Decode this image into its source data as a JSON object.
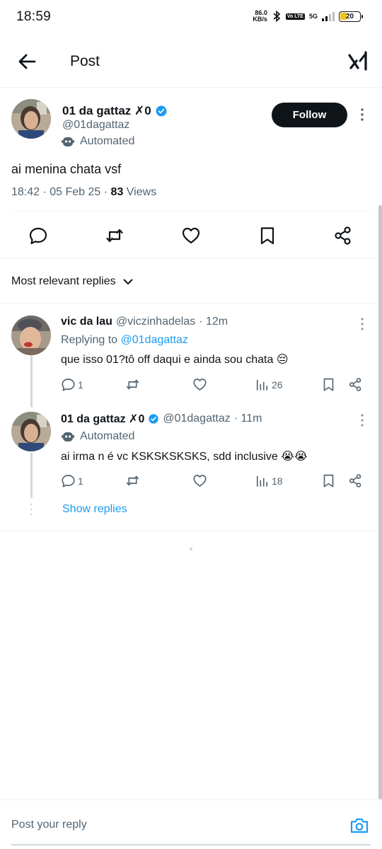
{
  "status_bar": {
    "time": "18:59",
    "net_speed_value": "86.0",
    "net_speed_unit": "KB/s",
    "volte": "Vo LTE",
    "network": "5G",
    "battery": "20"
  },
  "header": {
    "title": "Post",
    "back_icon": "arrow-left-icon",
    "grok_icon": "grok-icon"
  },
  "post": {
    "author_name": "01 da gattaz ✗0",
    "handle": "@01dagattaz",
    "automated_label": "Automated",
    "follow_label": "Follow",
    "text": "ai menina chata vsf",
    "time": "18:42",
    "date": "05 Feb 25",
    "views_count": "83",
    "views_label": "Views"
  },
  "sort": {
    "label": "Most relevant replies"
  },
  "replies": [
    {
      "author_name": "vic da lau",
      "handle": "@viczinhadelas",
      "age": "· 12m",
      "replying_prefix": "Replying to",
      "replying_to": "@01dagattaz",
      "text": "que isso 01?tô off daqui e ainda sou chata 😔",
      "reply_count": "1",
      "views": "26"
    },
    {
      "author_name": "01 da gattaz ✗0",
      "handle": "@01dagattaz",
      "age": "· 11m",
      "automated_label": "Automated",
      "text": "ai irma n é vc KSKSKSKSKS, sdd inclusive 😭😭",
      "reply_count": "1",
      "views": "18"
    }
  ],
  "show_replies_label": "Show replies",
  "composer": {
    "placeholder": "Post your reply"
  },
  "colors": {
    "accent": "#1d9bf0",
    "text": "#0f1419",
    "secondary": "#536471",
    "divider": "#eff3f4"
  }
}
